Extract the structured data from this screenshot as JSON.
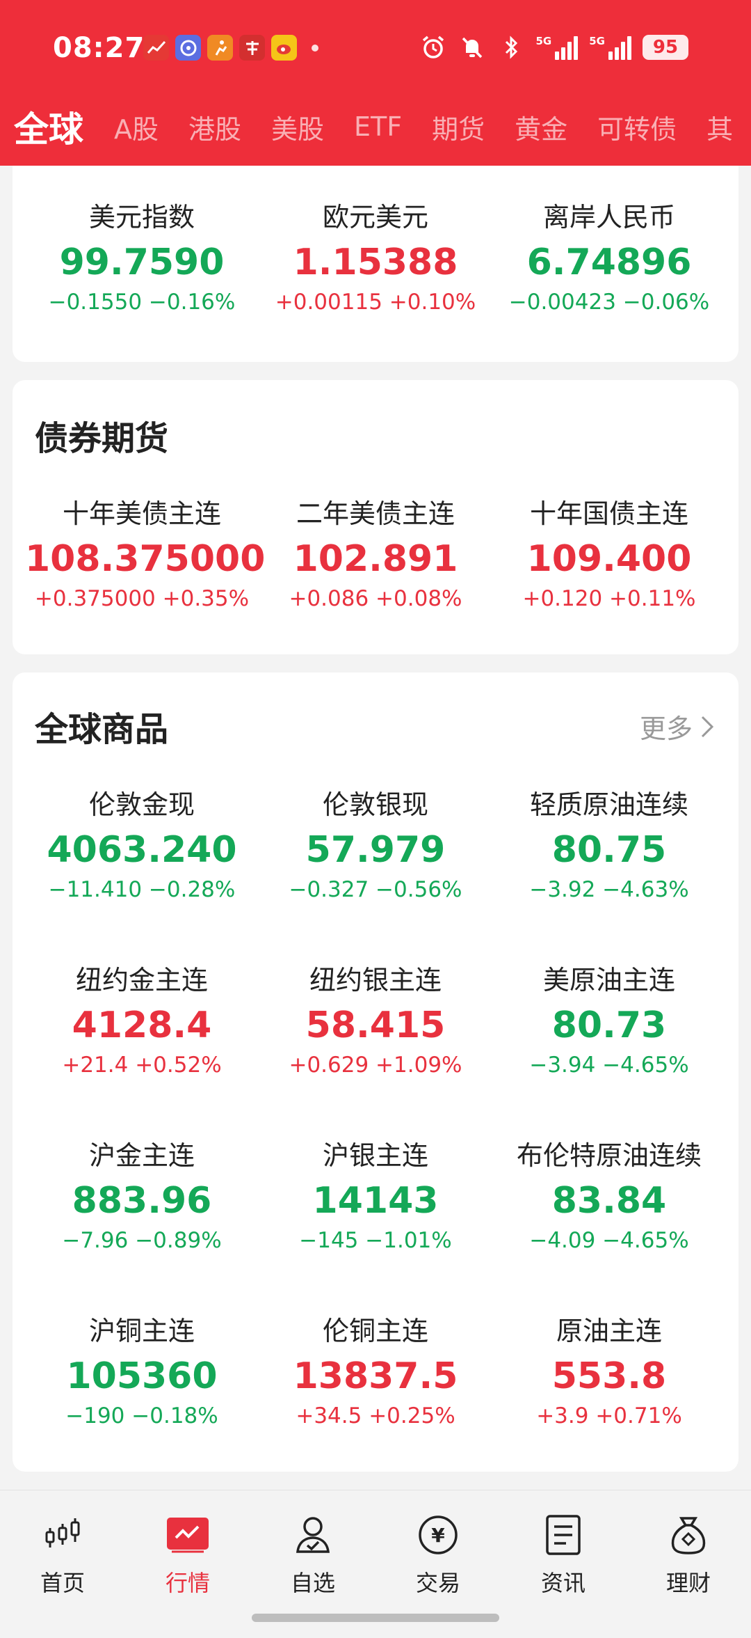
{
  "status_bar": {
    "time": "08:27",
    "network_1": "5G",
    "network_2": "5G",
    "battery": "95",
    "app_icons": [
      "chart-app-icon",
      "browser-app-icon",
      "runner-app-icon",
      "red-app-icon",
      "weibo-app-icon"
    ]
  },
  "tabs": [
    "全球",
    "A股",
    "港股",
    "美股",
    "ETF",
    "期货",
    "黄金",
    "可转债",
    "其"
  ],
  "forex": [
    {
      "name": "美元指数",
      "value": "99.7590",
      "change": "−0.1550 −0.16%",
      "dir": "down"
    },
    {
      "name": "欧元美元",
      "value": "1.15388",
      "change": "+0.00115 +0.10%",
      "dir": "up"
    },
    {
      "name": "离岸人民币",
      "value": "6.74896",
      "change": "−0.00423 −0.06%",
      "dir": "down"
    }
  ],
  "bond_section": {
    "title": "债券期货",
    "items": [
      {
        "name": "十年美债主连",
        "value": "108.375000",
        "change": "+0.375000 +0.35%",
        "dir": "up"
      },
      {
        "name": "二年美债主连",
        "value": "102.891",
        "change": "+0.086 +0.08%",
        "dir": "up"
      },
      {
        "name": "十年国债主连",
        "value": "109.400",
        "change": "+0.120 +0.11%",
        "dir": "up"
      }
    ]
  },
  "commodity_section": {
    "title": "全球商品",
    "more_label": "更多",
    "items": [
      {
        "name": "伦敦金现",
        "value": "4063.240",
        "change": "−11.410 −0.28%",
        "dir": "down"
      },
      {
        "name": "伦敦银现",
        "value": "57.979",
        "change": "−0.327 −0.56%",
        "dir": "down"
      },
      {
        "name": "轻质原油连续",
        "value": "80.75",
        "change": "−3.92 −4.63%",
        "dir": "down"
      },
      {
        "name": "纽约金主连",
        "value": "4128.4",
        "change": "+21.4 +0.52%",
        "dir": "up"
      },
      {
        "name": "纽约银主连",
        "value": "58.415",
        "change": "+0.629 +1.09%",
        "dir": "up"
      },
      {
        "name": "美原油主连",
        "value": "80.73",
        "change": "−3.94 −4.65%",
        "dir": "down"
      },
      {
        "name": "沪金主连",
        "value": "883.96",
        "change": "−7.96 −0.89%",
        "dir": "down"
      },
      {
        "name": "沪银主连",
        "value": "14143",
        "change": "−145 −1.01%",
        "dir": "down"
      },
      {
        "name": "布伦特原油连续",
        "value": "83.84",
        "change": "−4.09 −4.65%",
        "dir": "down"
      },
      {
        "name": "沪铜主连",
        "value": "105360",
        "change": "−190 −0.18%",
        "dir": "down"
      },
      {
        "name": "伦铜主连",
        "value": "13837.5",
        "change": "+34.5 +0.25%",
        "dir": "up"
      },
      {
        "name": "原油主连",
        "value": "553.8",
        "change": "+3.9 +0.71%",
        "dir": "up"
      }
    ]
  },
  "bottom_nav": [
    {
      "label": "首页",
      "icon": "candlestick-icon"
    },
    {
      "label": "行情",
      "icon": "market-chart-icon"
    },
    {
      "label": "自选",
      "icon": "person-check-icon"
    },
    {
      "label": "交易",
      "icon": "yuan-coin-icon"
    },
    {
      "label": "资讯",
      "icon": "news-document-icon"
    },
    {
      "label": "理财",
      "icon": "money-bag-icon"
    }
  ],
  "colors": {
    "brand": "#ee2e3a",
    "up": "#e8313e",
    "down": "#14a857"
  }
}
